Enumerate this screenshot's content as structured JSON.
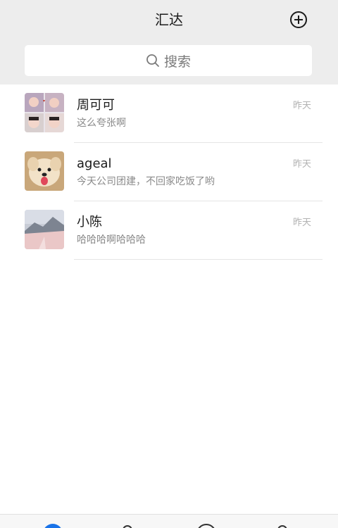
{
  "header": {
    "title": "汇达",
    "add_icon": "plus-circle-icon"
  },
  "search": {
    "icon": "search-icon",
    "placeholder": "搜索"
  },
  "chats": [
    {
      "name": "周可可",
      "preview": "这么夸张啊",
      "time": "昨天",
      "avatar": "baby-collage-avatar"
    },
    {
      "name": "ageal",
      "preview": "今天公司团建，不回家吃饭了哟",
      "time": "昨天",
      "avatar": "puppy-avatar"
    },
    {
      "name": "小陈",
      "preview": "哈哈哈啊哈哈哈",
      "time": "昨天",
      "avatar": "snow-mountain-avatar"
    }
  ],
  "tabbar": {
    "icons": [
      "chat-icon",
      "contacts-icon",
      "discover-icon",
      "me-icon"
    ],
    "active_color": "#1a73e8"
  }
}
